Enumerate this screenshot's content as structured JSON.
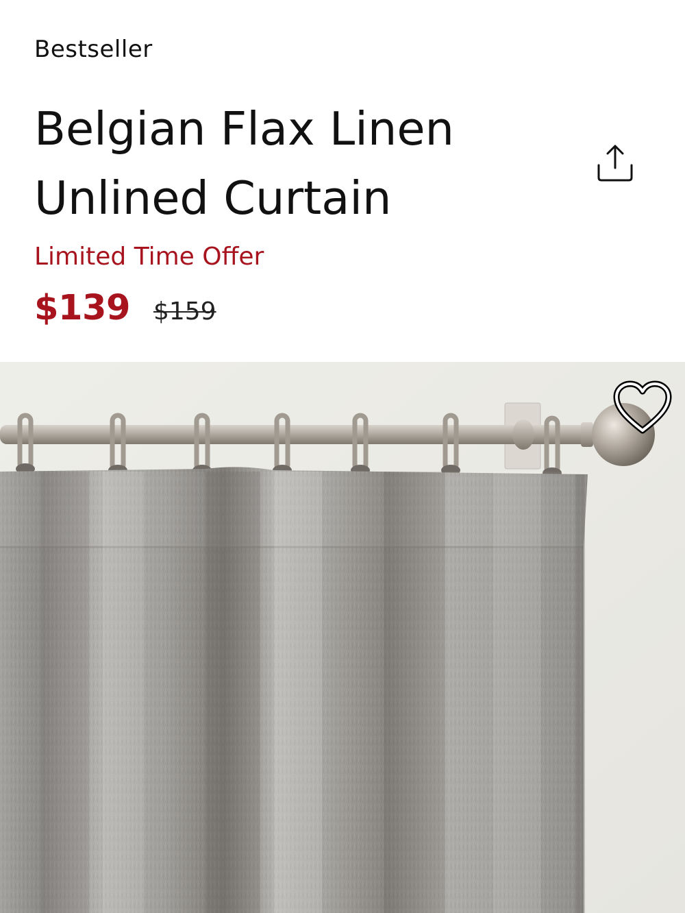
{
  "product": {
    "badge": "Bestseller",
    "title": "Belgian Flax Linen Unlined Curtain",
    "offer_label": "Limited Time Offer",
    "sale_price": "$139",
    "original_price": "$159"
  },
  "icons": {
    "share": "share-icon",
    "favorite": "heart-icon"
  },
  "colors": {
    "sale_red": "#a8141e",
    "text": "#111111",
    "curtain": "#9a9894",
    "wall": "#ecebe6",
    "rod": "#a9a29a"
  }
}
